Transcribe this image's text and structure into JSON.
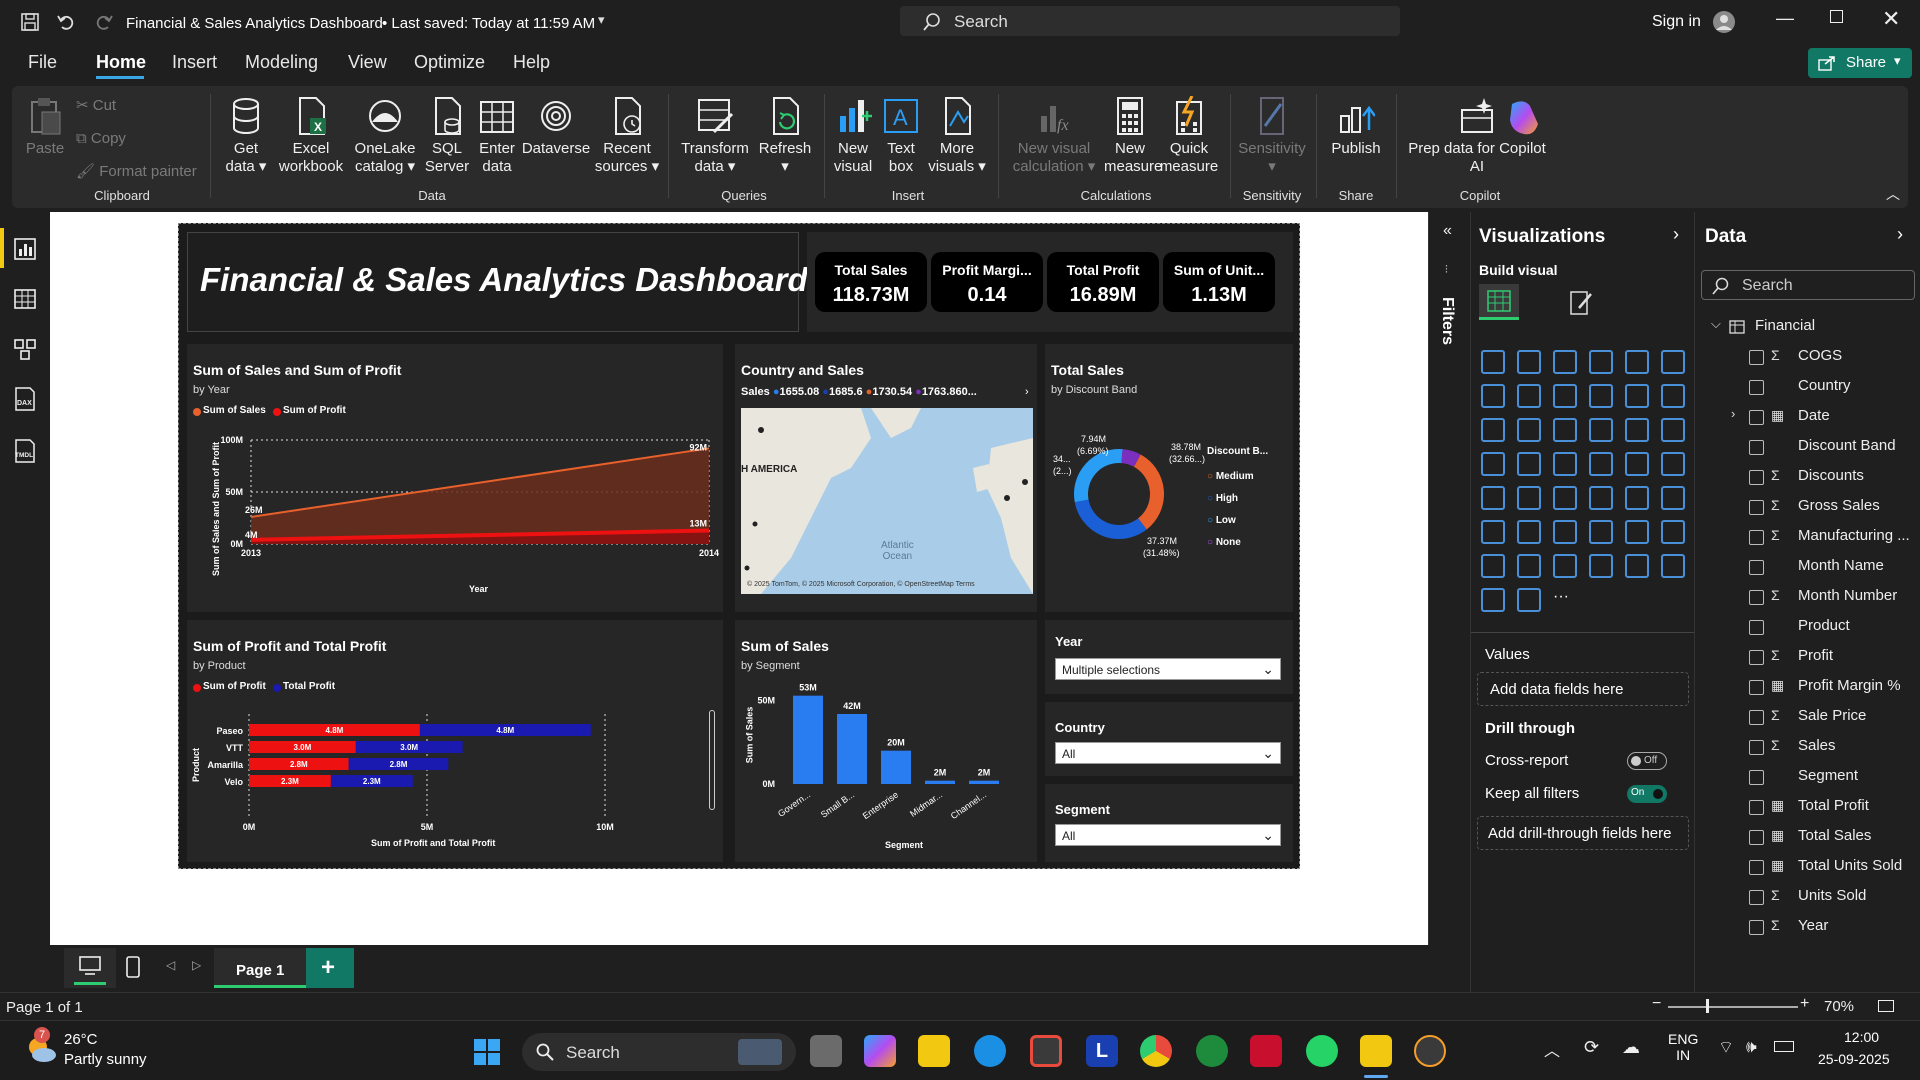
{
  "app": {
    "title": "Financial & Sales Analytics Dashboard",
    "saved": "• Last saved: Today at 11:59 AM",
    "search_placeholder": "Search",
    "sign_in": "Sign in"
  },
  "menu": {
    "items": [
      "File",
      "Home",
      "Insert",
      "Modeling",
      "View",
      "Optimize",
      "Help"
    ],
    "active": "Home",
    "share": "Share"
  },
  "ribbon": {
    "clipboard": {
      "paste": "Paste",
      "cut": "Cut",
      "copy": "Copy",
      "format_painter": "Format painter",
      "group": "Clipboard"
    },
    "data": {
      "get_data": [
        "Get",
        "data ▾"
      ],
      "excel": [
        "Excel",
        "workbook"
      ],
      "onelake": [
        "OneLake",
        "catalog ▾"
      ],
      "sql": [
        "SQL",
        "Server"
      ],
      "enter": [
        "Enter",
        "data"
      ],
      "dataverse": [
        "Dataverse",
        ""
      ],
      "recent": [
        "Recent",
        "sources ▾"
      ],
      "group": "Data"
    },
    "queries": {
      "transform": [
        "Transform",
        "data ▾"
      ],
      "refresh": [
        "Refresh",
        "▾"
      ],
      "group": "Queries"
    },
    "insert": {
      "new_visual": [
        "New",
        "visual"
      ],
      "text_box": [
        "Text",
        "box"
      ],
      "more_visuals": [
        "More",
        "visuals ▾"
      ],
      "group": "Insert"
    },
    "calculations": {
      "new_visual_calc": [
        "New visual",
        "calculation ▾"
      ],
      "new_measure": [
        "New",
        "measure"
      ],
      "quick_measure": [
        "Quick",
        "measure"
      ],
      "group": "Calculations"
    },
    "sensitivity": {
      "label": [
        "Sensitivity",
        "▾"
      ],
      "group": "Sensitivity"
    },
    "share": {
      "publish": [
        "Publish",
        ""
      ],
      "group": "Share"
    },
    "copilot": {
      "prep": [
        "Prep data for Copilot",
        "AI"
      ],
      "group": "Copilot"
    }
  },
  "report": {
    "title": "Financial & Sales Analytics Dashboard",
    "kpis": [
      {
        "label": "Total Sales",
        "value": "118.73M"
      },
      {
        "label": "Profit Margi...",
        "value": "0.14"
      },
      {
        "label": "Total Profit",
        "value": "16.89M"
      },
      {
        "label": "Sum of Unit...",
        "value": "1.13M"
      }
    ],
    "area": {
      "title": "Sum of Sales and Sum of Profit",
      "subtitle": "by Year",
      "legend": [
        "Sum of Sales",
        "Sum of Profit"
      ],
      "yaxis": "Sum of Sales and Sum of Profit",
      "xaxis": "Year",
      "ticks_y": [
        "100M",
        "50M",
        "0M"
      ],
      "ticks_x": [
        "2013",
        "2014"
      ],
      "labels": [
        "92M",
        "26M",
        "4M",
        "13M"
      ]
    },
    "map": {
      "title": "Country and Sales",
      "legend_label": "Sales",
      "legend": [
        "1655.08",
        "1685.6",
        "1730.54",
        "1763.860..."
      ],
      "region": "H AMERICA",
      "ocean": [
        "Atlantic",
        "Ocean"
      ],
      "attribution": "© 2025 TomTom, © 2025 Microsoft Corporation, © OpenStreetMap Terms"
    },
    "donut": {
      "title": "Total Sales",
      "subtitle": "by Discount Band",
      "legend_title": "Discount B...",
      "legend": [
        "Medium",
        "High",
        "Low",
        "None"
      ],
      "labels": [
        "7.94M",
        "(6.69%)",
        "38.78M",
        "(32.66...)",
        "34...",
        "(2...)",
        "37.37M",
        "(31.48%)"
      ]
    },
    "hbar": {
      "title": "Sum of Profit and Total Profit",
      "subtitle": "by Product",
      "legend": [
        "Sum of Profit",
        "Total Profit"
      ],
      "yaxis": "Product",
      "xaxis": "Sum of Profit and Total Profit",
      "ticks_x": [
        "0M",
        "5M",
        "10M"
      ]
    },
    "vbar": {
      "title": "Sum of Sales",
      "subtitle": "by Segment",
      "yaxis": "Sum of Sales",
      "xaxis": "Segment",
      "ticks_y": [
        "50M",
        "0M"
      ],
      "categories": [
        "Govern...",
        "Small B...",
        "Enterprise",
        "Midmar...",
        "Channel..."
      ],
      "labels": [
        "53M",
        "42M",
        "20M",
        "2M",
        "2M"
      ]
    },
    "slicers": [
      {
        "title": "Year",
        "value": "Multiple selections"
      },
      {
        "title": "Country",
        "value": "All"
      },
      {
        "title": "Segment",
        "value": "All"
      }
    ]
  },
  "chart_data": [
    {
      "type": "area",
      "title": "Sum of Sales and Sum of Profit",
      "x": [
        2013,
        2014
      ],
      "series": [
        {
          "name": "Sum of Sales",
          "values": [
            26,
            92
          ]
        },
        {
          "name": "Sum of Profit",
          "values": [
            4,
            13
          ]
        }
      ],
      "ylim": [
        0,
        100
      ],
      "xlabel": "Year",
      "ylabel": "Sum of Sales and Sum of Profit",
      "unit": "M"
    },
    {
      "type": "pie",
      "title": "Total Sales",
      "categories": [
        "Medium",
        "High",
        "Low",
        "None"
      ],
      "values": [
        37.37,
        38.78,
        34.6,
        7.94
      ],
      "unit": "M",
      "colors": [
        "#e8612c",
        "#1a5fd6",
        "#2a9df4",
        "#7b2fbe"
      ]
    },
    {
      "type": "bar",
      "orientation": "horizontal",
      "title": "Sum of Profit and Total Profit",
      "categories": [
        "Paseo",
        "VTT",
        "Amarilla",
        "Velo"
      ],
      "series": [
        {
          "name": "Sum of Profit",
          "values": [
            4.8,
            3.0,
            2.8,
            2.3
          ]
        },
        {
          "name": "Total Profit",
          "values": [
            4.8,
            3.0,
            2.8,
            2.3
          ]
        }
      ],
      "xlim": [
        0,
        10
      ],
      "unit": "M",
      "xlabel": "Sum of Profit and Total Profit",
      "ylabel": "Product"
    },
    {
      "type": "bar",
      "title": "Sum of Sales",
      "categories": [
        "Govern...",
        "Small B...",
        "Enterprise",
        "Midmar...",
        "Channel..."
      ],
      "values": [
        53,
        42,
        20,
        2,
        2
      ],
      "ylim": [
        0,
        60
      ],
      "unit": "M",
      "xlabel": "Segment",
      "ylabel": "Sum of Sales"
    }
  ],
  "filters": {
    "label": "Filters"
  },
  "viz": {
    "title": "Visualizations",
    "build": "Build visual",
    "values": "Values",
    "add_data": "Add data fields here",
    "drill": "Drill through",
    "cross_report": "Cross-report",
    "cross_state": "Off",
    "keep_filters": "Keep all filters",
    "keep_state": "On",
    "add_drill": "Add drill-through fields here"
  },
  "data_pane": {
    "title": "Data",
    "search": "Search",
    "table": "Financial",
    "fields": [
      {
        "sig": "Σ",
        "name": "COGS"
      },
      {
        "sig": "",
        "name": "Country"
      },
      {
        "sig": "▦",
        "name": "Date"
      },
      {
        "sig": "",
        "name": "Discount Band"
      },
      {
        "sig": "Σ",
        "name": "Discounts"
      },
      {
        "sig": "Σ",
        "name": "Gross Sales"
      },
      {
        "sig": "Σ",
        "name": "Manufacturing ..."
      },
      {
        "sig": "",
        "name": "Month Name"
      },
      {
        "sig": "Σ",
        "name": "Month Number"
      },
      {
        "sig": "",
        "name": "Product"
      },
      {
        "sig": "Σ",
        "name": "Profit"
      },
      {
        "sig": "▦",
        "name": "Profit Margin %"
      },
      {
        "sig": "Σ",
        "name": "Sale Price"
      },
      {
        "sig": "Σ",
        "name": "Sales"
      },
      {
        "sig": "",
        "name": "Segment"
      },
      {
        "sig": "▦",
        "name": "Total Profit"
      },
      {
        "sig": "▦",
        "name": "Total Sales"
      },
      {
        "sig": "▦",
        "name": "Total Units Sold"
      },
      {
        "sig": "Σ",
        "name": "Units Sold"
      },
      {
        "sig": "Σ",
        "name": "Year"
      }
    ]
  },
  "pages": {
    "current": "Page 1",
    "add": "+"
  },
  "status": {
    "page": "Page 1 of 1",
    "zoom": "70%"
  },
  "taskbar": {
    "weather_temp": "26°C",
    "weather_desc": "Partly sunny",
    "weather_badge": "7",
    "search": "Search",
    "lang": [
      "ENG",
      "IN"
    ],
    "time": "12:00",
    "date": "25-09-2025"
  }
}
